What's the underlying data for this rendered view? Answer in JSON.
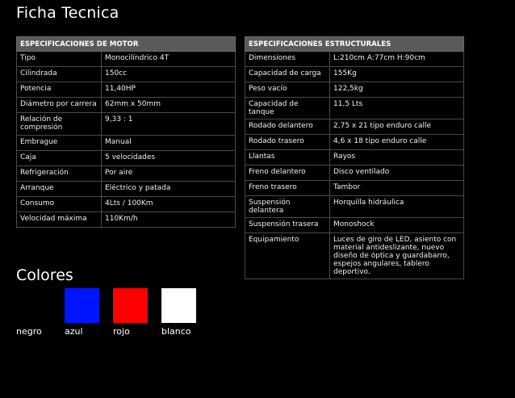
{
  "page_title": "Ficha Tecnica",
  "motor": {
    "header": "ESPECIFICACIONES DE MOTOR",
    "rows": [
      {
        "label": "Tipo",
        "value": "Monocilíndrico 4T"
      },
      {
        "label": "Cilindrada",
        "value": "150cc"
      },
      {
        "label": "Potencia",
        "value": "11,40HP"
      },
      {
        "label": "Diámetro por carrera",
        "value": "62mm x 50mm"
      },
      {
        "label": "Relación de compresión",
        "value": "9,33 : 1"
      },
      {
        "label": "Embrague",
        "value": "Manual"
      },
      {
        "label": "Caja",
        "value": "5 velocidades"
      },
      {
        "label": "Refrigeración",
        "value": "Por aire"
      },
      {
        "label": "Arranque",
        "value": "Eléctrico y patada"
      },
      {
        "label": "Consumo",
        "value": "4Lts / 100Km"
      },
      {
        "label": "Velocidad máxima",
        "value": "110Km/h"
      }
    ]
  },
  "estructural": {
    "header": "ESPECIFICACIONES ESTRUCTURALES",
    "rows": [
      {
        "label": "Dimensiones",
        "value": "L:210cm A:77cm H:90cm"
      },
      {
        "label": "Capacidad de carga",
        "value": "155Kg"
      },
      {
        "label": "Peso vacío",
        "value": "122,5kg"
      },
      {
        "label": "Capacidad de tanque",
        "value": "11,5 Lts"
      },
      {
        "label": "Rodado delantero",
        "value": "2,75 x 21 tipo enduro calle"
      },
      {
        "label": "Rodado trasero",
        "value": "4,6 x 18 tipo enduro calle"
      },
      {
        "label": "Llantas",
        "value": "Rayos"
      },
      {
        "label": "Freno delantero",
        "value": "Disco ventilado"
      },
      {
        "label": "Freno trasero",
        "value": "Tambor"
      },
      {
        "label": "Suspensión delantera",
        "value": "Horquilla hidráulica"
      },
      {
        "label": "Suspensión trasera",
        "value": "Monoshock"
      },
      {
        "label": "Equipamiento",
        "value": "Luces de giro de LED, asiento con material antideslizante, nuevo diseño de óptica y guardabarro, espejos angulares, tablero deportivo."
      }
    ]
  },
  "colors": {
    "title": "Colores",
    "items": [
      {
        "name": "negro",
        "hex": "#000000"
      },
      {
        "name": "azul",
        "hex": "#0015ff"
      },
      {
        "name": "rojo",
        "hex": "#ff0000"
      },
      {
        "name": "blanco",
        "hex": "#ffffff"
      }
    ]
  }
}
